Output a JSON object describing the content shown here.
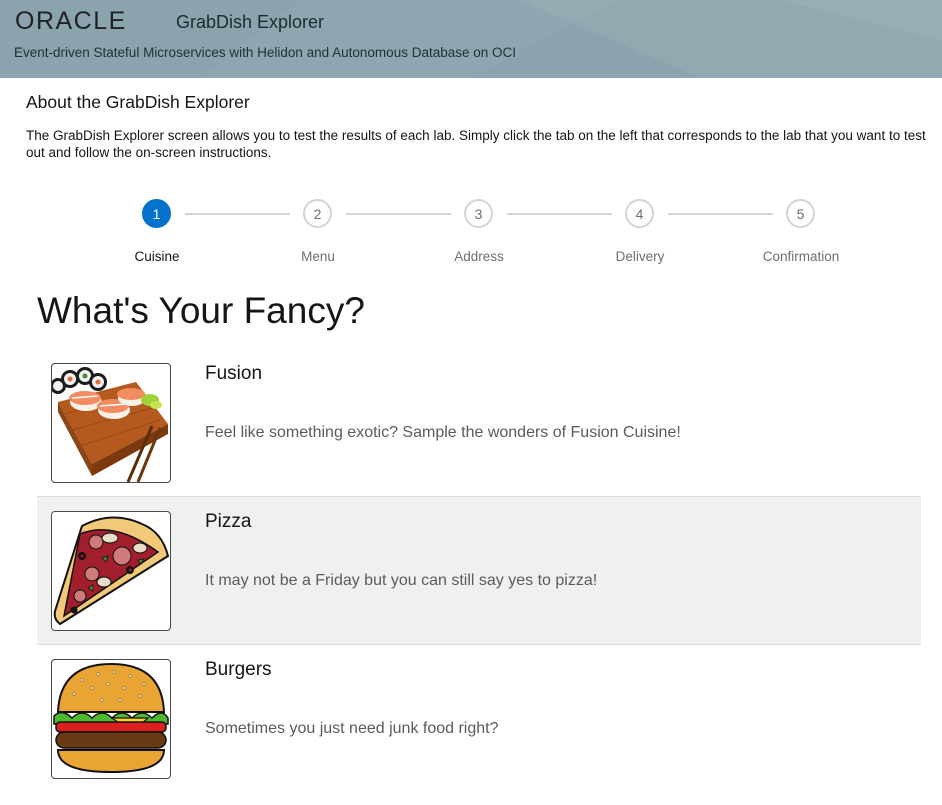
{
  "header": {
    "logo_text": "ORACLE",
    "app_title": "GrabDish Explorer",
    "subtitle": "Event-driven Stateful Microservices with Helidon and Autonomous Database on OCI",
    "background_color": "#8aa3ad"
  },
  "about": {
    "title": "About the GrabDish Explorer",
    "text": "The GrabDish Explorer screen allows you to test the results of each lab. Simply click the tab on the left that corresponds to the lab that you want to test out and follow the on-screen instructions."
  },
  "train": {
    "active_color": "#0572ce",
    "steps": [
      {
        "number": "1",
        "label": "Cuisine",
        "active": true
      },
      {
        "number": "2",
        "label": "Menu",
        "active": false
      },
      {
        "number": "3",
        "label": "Address",
        "active": false
      },
      {
        "number": "4",
        "label": "Delivery",
        "active": false
      },
      {
        "number": "5",
        "label": "Confirmation",
        "active": false
      }
    ]
  },
  "page_heading": "What's Your Fancy?",
  "cuisines": [
    {
      "title": "Fusion",
      "description": "Feel like something exotic? Sample the wonders of Fusion Cuisine!",
      "image": "sushi-platter-image",
      "highlighted": false
    },
    {
      "title": "Pizza",
      "description": "It may not be a Friday but you can still say yes to pizza!",
      "image": "pizza-slice-image",
      "highlighted": true
    },
    {
      "title": "Burgers",
      "description": "Sometimes you just need junk food right?",
      "image": "burger-image",
      "highlighted": false
    }
  ]
}
